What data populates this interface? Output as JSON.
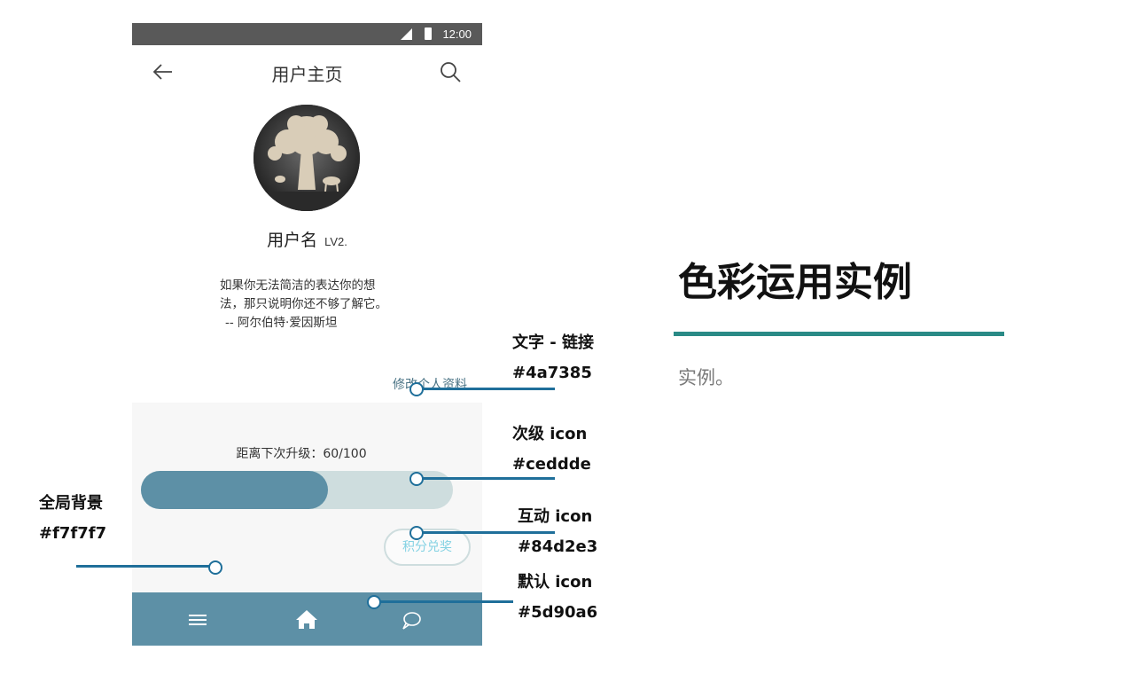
{
  "status_bar": {
    "time": "12:00"
  },
  "app_bar": {
    "title": "用户主页",
    "back_icon": "arrow-left-icon",
    "search_icon": "search-icon"
  },
  "profile": {
    "username": "用户名",
    "level": "LV2.",
    "quote_line1": "如果你无法简洁的表达你的想",
    "quote_line2": "法，那只说明你还不够了解它。",
    "quote_author": "-- 阿尔伯特·爱因斯坦",
    "edit_link": "修改个人资料"
  },
  "progress": {
    "label": "距离下次升级：60/100",
    "current": 60,
    "max": 100
  },
  "redeem_button": "积分兑奖",
  "tab_bar": {
    "items": [
      "menu-icon",
      "home-icon",
      "chat-bubble-icon"
    ]
  },
  "annotations": {
    "link_text": {
      "title": "文字 - 链接",
      "color": "#4a7385"
    },
    "secondary_icon": {
      "title": "次级 icon",
      "color": "#ceddde"
    },
    "global_bg": {
      "title": "全局背景",
      "color": "#f7f7f7"
    },
    "interactive_icon": {
      "title": "互动 icon",
      "color": "#84d2e3"
    },
    "default_icon": {
      "title": "默认 icon",
      "color": "#5d90a6"
    }
  },
  "right_panel": {
    "title": "色彩运用实例",
    "subtitle": "实例。"
  }
}
